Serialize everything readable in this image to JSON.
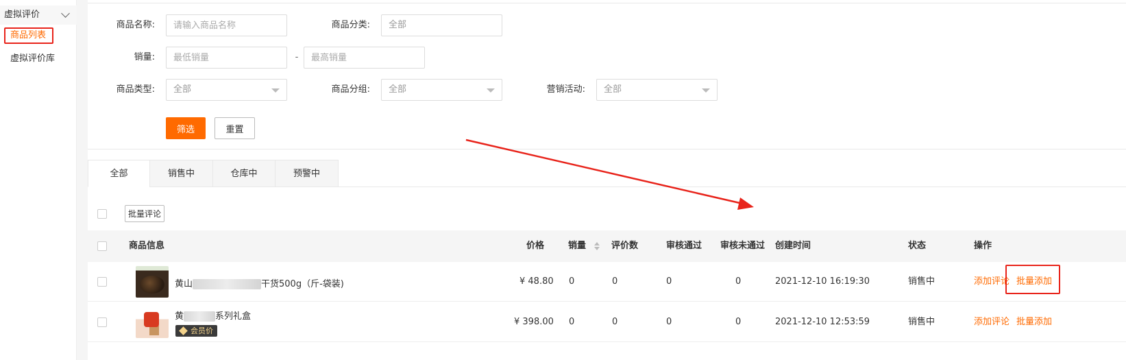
{
  "sidebar": {
    "group_label": "虚拟评价",
    "items": [
      {
        "label": "商品列表",
        "active": true
      },
      {
        "label": "虚拟评价库",
        "active": false
      }
    ]
  },
  "filters": {
    "name_label": "商品名称:",
    "name_placeholder": "请输入商品名称",
    "category_label": "商品分类:",
    "category_value": "全部",
    "sales_label": "销量:",
    "sales_min_placeholder": "最低销量",
    "sales_sep": "-",
    "sales_max_placeholder": "最高销量",
    "type_label": "商品类型:",
    "type_value": "全部",
    "group_label": "商品分组:",
    "group_value": "全部",
    "promo_label": "营销活动:",
    "promo_value": "全部",
    "filter_button": "筛选",
    "reset_button": "重置"
  },
  "tabs": [
    {
      "label": "全部",
      "active": true
    },
    {
      "label": "销售中",
      "active": false
    },
    {
      "label": "仓库中",
      "active": false
    },
    {
      "label": "预警中",
      "active": false
    }
  ],
  "toolbar": {
    "batch_comment_button": "批量评论"
  },
  "table": {
    "headers": {
      "info": "商品信息",
      "price": "价格",
      "sales": "销量",
      "reviews": "评价数",
      "approved": "审核通过",
      "rejected": "审核未通过",
      "created": "创建时间",
      "status": "状态",
      "actions": "操作"
    },
    "rows": [
      {
        "name_prefix": "黄山",
        "name_suffix": "干货500g（斤-袋装)",
        "badge": "",
        "price": "¥ 48.80",
        "sales": "0",
        "reviews": "0",
        "approved": "0",
        "rejected": "0",
        "created": "2021-12-10 16:19:30",
        "status": "销售中",
        "action_add_review": "添加评论",
        "action_batch_add": "批量添加"
      },
      {
        "name_prefix": "黄",
        "name_suffix": "系列礼盒",
        "badge": "会员价",
        "price": "¥ 398.00",
        "sales": "0",
        "reviews": "0",
        "approved": "0",
        "rejected": "0",
        "created": "2021-12-10 12:53:59",
        "status": "销售中",
        "action_add_review": "添加评论",
        "action_batch_add": "批量添加"
      }
    ]
  },
  "colors": {
    "accent": "#ff6a00",
    "annotation": "#e8231a"
  }
}
